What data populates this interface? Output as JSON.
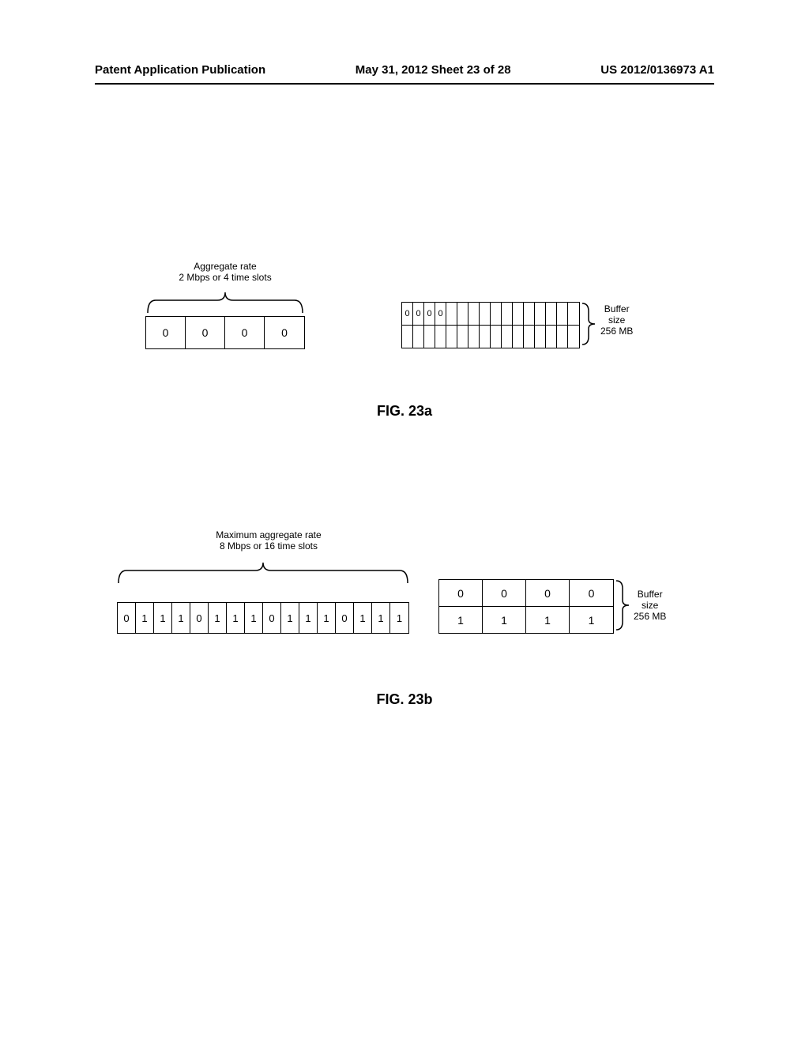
{
  "header": {
    "left": "Patent Application Publication",
    "middle": "May 31, 2012  Sheet 23 of 28",
    "right": "US 2012/0136973 A1"
  },
  "figA": {
    "aggregateLabel1": "Aggregate rate",
    "aggregateLabel2": "2 Mbps or 4 time slots",
    "slots": [
      "0",
      "0",
      "0",
      "0"
    ],
    "bufferRow1": [
      "0",
      "0",
      "0",
      "0",
      "",
      "",
      "",
      "",
      "",
      "",
      "",
      "",
      "",
      "",
      "",
      ""
    ],
    "bufferRow2": [
      "",
      "",
      "",
      "",
      "",
      "",
      "",
      "",
      "",
      "",
      "",
      "",
      "",
      "",
      "",
      ""
    ],
    "bufferLabel1": "Buffer",
    "bufferLabel2": "size",
    "bufferLabel3": "256 MB",
    "caption": "FIG. 23a"
  },
  "figB": {
    "aggregateLabel1": "Maximum aggregate rate",
    "aggregateLabel2": "8 Mbps or 16 time slots",
    "slots": [
      "0",
      "1",
      "1",
      "1",
      "0",
      "1",
      "1",
      "1",
      "0",
      "1",
      "1",
      "1",
      "0",
      "1",
      "1",
      "1"
    ],
    "bufferRow1": [
      "0",
      "0",
      "0",
      "0"
    ],
    "bufferRow2": [
      "1",
      "1",
      "1",
      "1"
    ],
    "bufferLabel1": "Buffer",
    "bufferLabel2": "size",
    "bufferLabel3": "256 MB",
    "caption": "FIG. 23b"
  },
  "chart_data": [
    {
      "type": "table",
      "title": "FIG. 23a - Aggregate rate 2 Mbps or 4 time slots",
      "timeslots": [
        0,
        0,
        0,
        0
      ],
      "buffer_size_mb": 256,
      "buffer_grid_rows": 2,
      "buffer_grid_cols": 16,
      "buffer_filled_top_row": [
        0,
        0,
        0,
        0
      ]
    },
    {
      "type": "table",
      "title": "FIG. 23b - Maximum aggregate rate 8 Mbps or 16 time slots",
      "timeslots": [
        0,
        1,
        1,
        1,
        0,
        1,
        1,
        1,
        0,
        1,
        1,
        1,
        0,
        1,
        1,
        1
      ],
      "buffer_size_mb": 256,
      "buffer_grid_rows": 2,
      "buffer_grid_cols": 4,
      "buffer_row1": [
        0,
        0,
        0,
        0
      ],
      "buffer_row2": [
        1,
        1,
        1,
        1
      ]
    }
  ]
}
